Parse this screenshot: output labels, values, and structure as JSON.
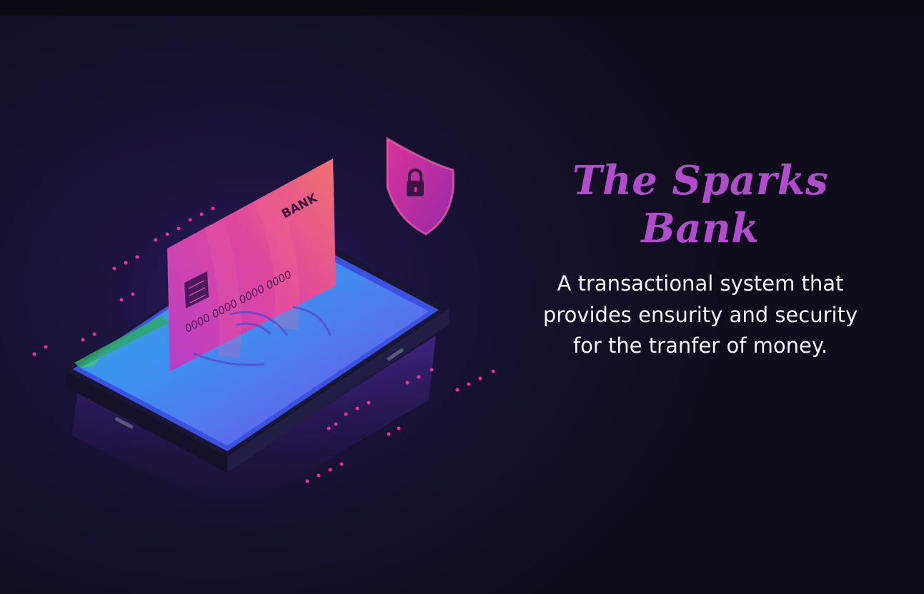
{
  "hero": {
    "title": "The Sparks Bank",
    "description": "A transactional system that\nprovides ensurity and security\nfor the tranfer of money."
  },
  "card": {
    "bank_label": "BANK",
    "number": "0000 0000 0000 0000"
  },
  "colors": {
    "background": "#0f0d1c",
    "title_accent": "#b14ccc",
    "card_pink": "#d63fa8",
    "phone_blue": "#3fa0f0",
    "dot_pink": "#e8329a"
  },
  "icons": {
    "shield": "shield-lock-icon",
    "chip": "card-chip-icon"
  }
}
